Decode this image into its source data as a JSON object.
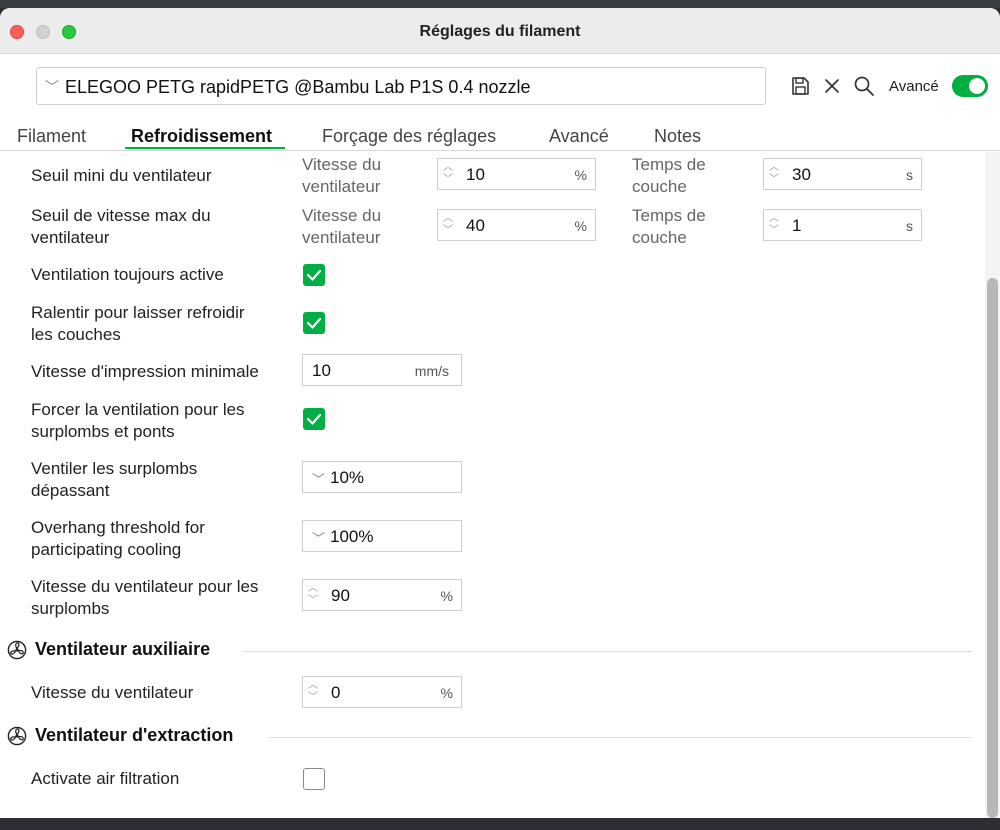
{
  "window": {
    "title": "Réglages du filament"
  },
  "preset": {
    "name": "ELEGOO PETG rapidPETG @Bambu Lab P1S 0.4 nozzle"
  },
  "toolbar": {
    "advanced_label": "Avancé",
    "advanced_on": true
  },
  "tabs": [
    {
      "label": "Filament",
      "active": false
    },
    {
      "label": "Refroidissement",
      "active": true
    },
    {
      "label": "Forçage des réglages",
      "active": false
    },
    {
      "label": "Avancé",
      "active": false
    },
    {
      "label": "Notes",
      "active": false
    }
  ],
  "cooling": {
    "min_fan_threshold": {
      "label": "Seuil mini du ventilateur",
      "speed_label": "Vitesse du ventilateur",
      "speed_label_line1": "Vitesse du",
      "speed_label_line2": "ventilateur",
      "speed_value": "10",
      "speed_unit": "%",
      "time_label_line1": "Temps de",
      "time_label_line2": "couche",
      "time_value": "30",
      "time_unit": "s"
    },
    "max_fan_threshold": {
      "label_line1": "Seuil de vitesse max du",
      "label_line2": "ventilateur",
      "speed_label_line1": "Vitesse du",
      "speed_label_line2": "ventilateur",
      "speed_value": "40",
      "speed_unit": "%",
      "time_label_line1": "Temps de",
      "time_label_line2": "couche",
      "time_value": "1",
      "time_unit": "s"
    },
    "fan_always_on": {
      "label": "Ventilation toujours active",
      "checked": true
    },
    "slow_down": {
      "label_line1": "Ralentir pour laisser refroidir",
      "label_line2": "les couches",
      "checked": true
    },
    "min_print_speed": {
      "label": "Vitesse d'impression minimale",
      "value": "10",
      "unit": "mm/s"
    },
    "force_overhang": {
      "label_line1": "Forcer la ventilation pour les",
      "label_line2": "surplombs et ponts",
      "checked": true
    },
    "overhang_exceeding": {
      "label_line1": "Ventiler les surplombs",
      "label_line2": "dépassant",
      "value": "10%"
    },
    "overhang_threshold": {
      "label_line1": "Overhang threshold for",
      "label_line2": "participating cooling",
      "value": "100%"
    },
    "overhang_fan_speed": {
      "label_line1": "Vitesse du ventilateur pour les",
      "label_line2": "surplombs",
      "value": "90",
      "unit": "%"
    }
  },
  "aux_fan": {
    "title": "Ventilateur auxiliaire",
    "speed_label": "Vitesse du ventilateur",
    "speed_value": "0",
    "speed_unit": "%"
  },
  "exhaust_fan": {
    "title": "Ventilateur d'extraction",
    "air_filtration_label": "Activate air filtration",
    "air_filtration_checked": false
  },
  "colors": {
    "accent": "#00ae42"
  }
}
